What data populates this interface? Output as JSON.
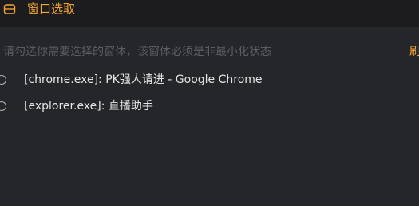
{
  "window": {
    "title": "窗口选取",
    "title_icon": "window-icon"
  },
  "instruction": "请勾选你需要选择的窗体，该窗体必须是非最小化状态",
  "refresh_label": "刷新",
  "items": [
    {
      "label": "[chrome.exe]: PK强人请进 - Google Chrome",
      "selected": false
    },
    {
      "label": "[explorer.exe]: 直播助手",
      "selected": false
    }
  ],
  "colors": {
    "accent": "#f3a433",
    "background": "#252629",
    "titlebar": "#1c1c1e",
    "text": "#e4e4e6",
    "muted": "#5c5d62"
  }
}
